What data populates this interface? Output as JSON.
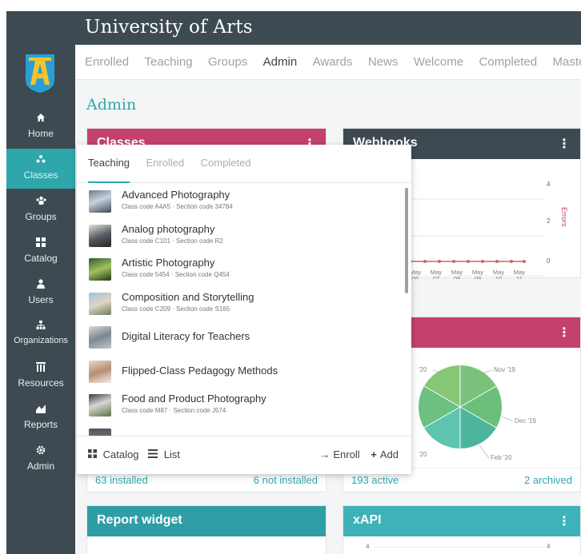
{
  "app": {
    "title": "University of Arts"
  },
  "sidebar": {
    "items": [
      {
        "label": "Home",
        "icon": "home-icon"
      },
      {
        "label": "Classes",
        "icon": "classes-icon"
      },
      {
        "label": "Groups",
        "icon": "groups-icon"
      },
      {
        "label": "Catalog",
        "icon": "catalog-icon"
      },
      {
        "label": "Users",
        "icon": "user-icon"
      },
      {
        "label": "Organizations",
        "icon": "organizations-icon"
      },
      {
        "label": "Resources",
        "icon": "resources-icon"
      },
      {
        "label": "Reports",
        "icon": "reports-icon"
      },
      {
        "label": "Admin",
        "icon": "gear-icon"
      }
    ]
  },
  "tabs": [
    "Enrolled",
    "Teaching",
    "Groups",
    "Admin",
    "Awards",
    "News",
    "Welcome",
    "Completed",
    "Mastery"
  ],
  "page_title": "Admin",
  "widgets": {
    "classes": {
      "title": "Classes",
      "footer_left": "63 installed",
      "footer_right": "6 not installed"
    },
    "webhooks": {
      "title": "Webhooks",
      "axis_right": "Errors",
      "y_ticks": [
        "4",
        "2",
        "0"
      ],
      "x_labels": [
        [
          "May",
          "06"
        ],
        [
          "May",
          "07"
        ],
        [
          "May",
          "08"
        ],
        [
          "May",
          "09"
        ],
        [
          "May",
          "10"
        ],
        [
          "May",
          "11"
        ]
      ]
    },
    "pie": {
      "labels": [
        "'20",
        "Nov '19",
        "Dec '19",
        "Feb '20",
        "'20"
      ],
      "footer_left": "193 active",
      "footer_right": "2 archived"
    },
    "report": {
      "title": "Report widget",
      "tick": "4"
    },
    "xapi": {
      "title": "xAPI",
      "tick_left": "4",
      "tick_right": "4"
    }
  },
  "dropdown": {
    "tabs": [
      "Teaching",
      "Enrolled",
      "Completed"
    ],
    "classes": [
      {
        "name": "Advanced Photography",
        "code": "Class code A4A5 · Section code 34784"
      },
      {
        "name": "Analog photography",
        "code": "Class code C101 · Section code R2"
      },
      {
        "name": "Artistic Photography",
        "code": "Class code 5454 · Section code Q454"
      },
      {
        "name": "Composition and Storytelling",
        "code": "Class code C209 · Section code S165"
      },
      {
        "name": "Digital Literacy for Teachers",
        "code": ""
      },
      {
        "name": "Flipped-Class Pedagogy Methods",
        "code": ""
      },
      {
        "name": "Food and Product Photography",
        "code": "Class code M87 · Section code J574"
      }
    ],
    "footer": {
      "catalog": "Catalog",
      "list": "List",
      "enroll": "Enroll",
      "add": "Add"
    }
  }
}
